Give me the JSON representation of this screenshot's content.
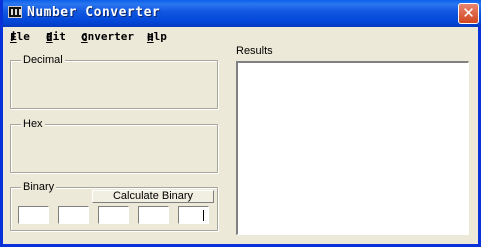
{
  "window": {
    "title": "Number Converter",
    "close_glyph": "✕"
  },
  "menu": [
    {
      "label": "File",
      "mnemonic": "F",
      "rest": "ile"
    },
    {
      "label": "Edit",
      "mnemonic": "E",
      "rest": "dit"
    },
    {
      "label": "Converter",
      "mnemonic": "C",
      "rest": "onverter"
    },
    {
      "label": "Help",
      "mnemonic": "H",
      "rest": "elp"
    }
  ],
  "groups": {
    "decimal": {
      "label": "Decimal"
    },
    "hex": {
      "label": "Hex"
    },
    "binary": {
      "label": "Binary",
      "button": "Calculate Binary",
      "fields": [
        "",
        "",
        "",
        "",
        ""
      ]
    }
  },
  "results": {
    "label": "Results",
    "text": ""
  },
  "icons": {
    "app": "app-icon",
    "close": "close-icon"
  }
}
